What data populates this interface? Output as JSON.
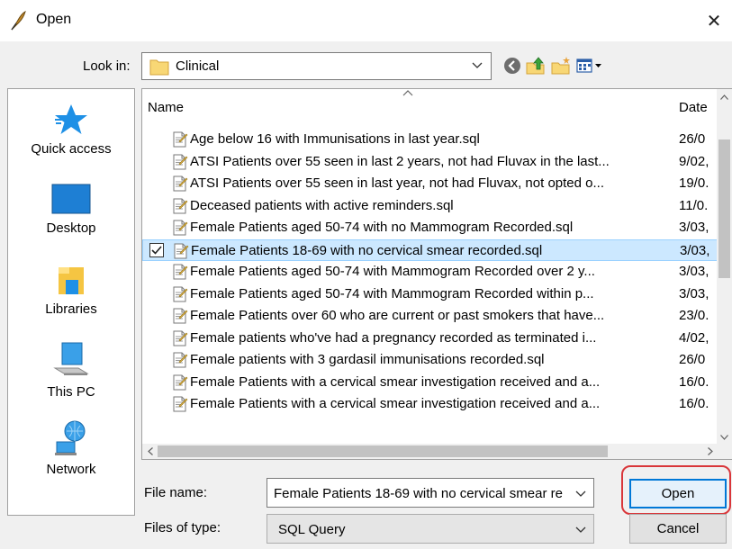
{
  "window": {
    "title": "Open",
    "close_glyph": "✕"
  },
  "lookin": {
    "label": "Look in:",
    "value": "Clinical"
  },
  "toolbar": {
    "icons": [
      "back-icon",
      "up-folder-icon",
      "new-folder-icon",
      "view-menu-icon"
    ]
  },
  "places": [
    {
      "label": "Quick access",
      "icon": "star-icon"
    },
    {
      "label": "Desktop",
      "icon": "desktop-icon"
    },
    {
      "label": "Libraries",
      "icon": "libraries-icon"
    },
    {
      "label": "This PC",
      "icon": "computer-icon"
    },
    {
      "label": "Network",
      "icon": "network-icon"
    }
  ],
  "filelist": {
    "headers": {
      "name": "Name",
      "date": "Date"
    },
    "rows": [
      {
        "name": "Age below 16 with Immunisations in last year.sql",
        "date": "26/0",
        "selected": false
      },
      {
        "name": "ATSI Patients over 55 seen in last 2 years, not had Fluvax in the last...",
        "date": "9/02,",
        "selected": false
      },
      {
        "name": "ATSI Patients over 55 seen in last year, not had Fluvax, not opted o...",
        "date": "19/0.",
        "selected": false
      },
      {
        "name": "Deceased patients with active reminders.sql",
        "date": "11/0.",
        "selected": false
      },
      {
        "name": "Female Patients  aged 50-74 with no Mammogram Recorded.sql",
        "date": "3/03,",
        "selected": false
      },
      {
        "name": "Female Patients 18-69 with no cervical smear recorded.sql",
        "date": "3/03,",
        "selected": true
      },
      {
        "name": "Female Patients aged 50-74 with Mammogram Recorded over 2 y...",
        "date": "3/03,",
        "selected": false
      },
      {
        "name": "Female Patients aged 50-74 with Mammogram Recorded within p...",
        "date": "3/03,",
        "selected": false
      },
      {
        "name": "Female Patients over 60 who are current or past smokers that have...",
        "date": "23/0.",
        "selected": false
      },
      {
        "name": "Female patients who've had a pregnancy recorded as terminated i...",
        "date": "4/02,",
        "selected": false
      },
      {
        "name": "Female patients with 3 gardasil immunisations recorded.sql",
        "date": "26/0",
        "selected": false
      },
      {
        "name": "Female Patients with a cervical smear investigation received and a...",
        "date": "16/0.",
        "selected": false
      },
      {
        "name": "Female Patients with a cervical smear investigation received and a...",
        "date": "16/0.",
        "selected": false
      }
    ]
  },
  "filename": {
    "label": "File name:",
    "value": "Female Patients 18-69 with no cervical smear re"
  },
  "filetype": {
    "label": "Files of type:",
    "value": "SQL Query"
  },
  "buttons": {
    "open": "Open",
    "cancel": "Cancel"
  },
  "colors": {
    "accent": "#0078d7",
    "selection": "#cce8ff",
    "highlight_ring": "#d9363a"
  }
}
